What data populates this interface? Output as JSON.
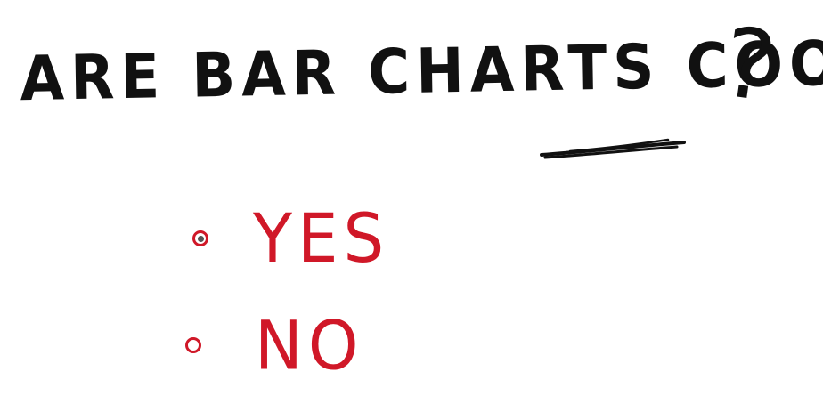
{
  "question": {
    "text": "ARE BAR CHARTS COOL",
    "mark": "?"
  },
  "options": [
    {
      "label": "YES",
      "selected": true
    },
    {
      "label": "NO",
      "selected": false
    }
  ],
  "colors": {
    "ink": "#111111",
    "answer": "#d01828",
    "radio_dot": "#555555"
  }
}
